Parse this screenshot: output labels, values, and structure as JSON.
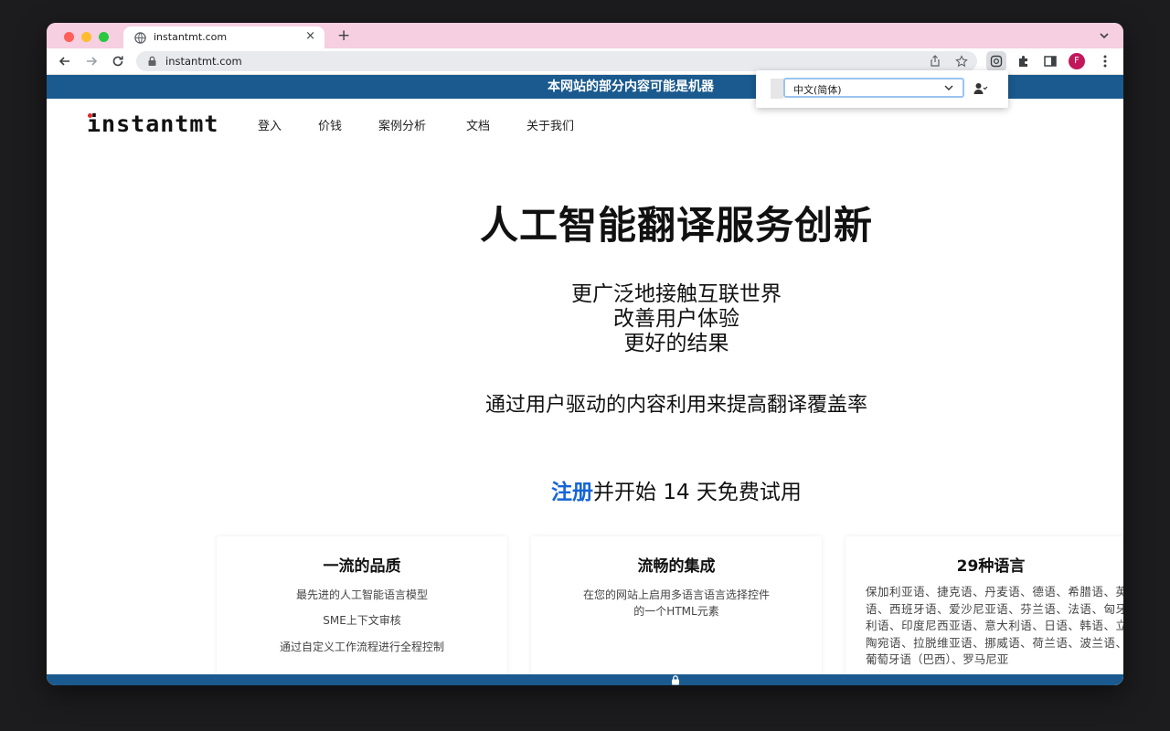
{
  "browser": {
    "tab_title": "instantmt.com",
    "tab_close": "×",
    "new_tab": "+",
    "url": "instantmt.com",
    "profile_initial": "F"
  },
  "site": {
    "banner_text": "本网站的部分内容可能是机器",
    "logo": "instantmt",
    "nav": [
      "登入",
      "价钱",
      "案例分析",
      "文档",
      "关于我们"
    ],
    "hero_title": "人工智能翻译服务创新",
    "hero_sub": [
      "更广泛地接触互联世界",
      "改善用户体验",
      "更好的结果"
    ],
    "hero_line": "通过用户驱动的内容利用来提高翻译覆盖率",
    "cta_link": "注册",
    "cta_rest": "并开始 14 天免费试用"
  },
  "cards": [
    {
      "title": "一流的品质",
      "lines": [
        "最先进的人工智能语言模型",
        "SME上下文审核",
        "通过自定义工作流程进行全程控制"
      ]
    },
    {
      "title": "流畅的集成",
      "lines": [
        "在您的网站上启用多语言语言选择控件",
        "的一个HTML元素"
      ]
    },
    {
      "title": "29种语言",
      "paragraph": "保加利亚语、捷克语、丹麦语、德语、希腊语、英语、西班牙语、爱沙尼亚语、芬兰语、法语、匈牙利语、印度尼西亚语、意大利语、日语、韩语、立陶宛语、拉脱维亚语、挪威语、荷兰语、波兰语、葡萄牙语（巴西）、罗马尼亚"
    }
  ],
  "popup": {
    "selected_language": "中文(简体)"
  },
  "colors": {
    "banner": "#1a5a8e",
    "tabstrip": "#f6cfe0",
    "cta_link": "#1565d8",
    "profile": "#c2185b"
  }
}
